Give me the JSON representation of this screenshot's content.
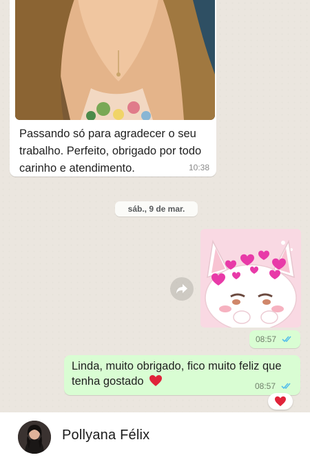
{
  "incoming": {
    "text": "Passando só para agradecer o seu trabalho.    Perfeito, obrigado por todo carinho e atendimento.",
    "time": "10:38"
  },
  "date_separator": "sáb., 9 de mar.",
  "sticker": {
    "icon": "cat-hearts-sticker",
    "bg": "#f9d9e3"
  },
  "sticker_message": {
    "time": "08:57",
    "status_icon": "double-check-icon"
  },
  "outgoing": {
    "text": "Linda, muito obrigado, fico muito feliz que tenha gostado",
    "time": "08:57",
    "status_icon": "double-check-icon",
    "emoji_icon": "red-heart-icon"
  },
  "reaction": {
    "icon": "red-heart-icon"
  },
  "footer": {
    "name": "Pollyana Félix"
  },
  "colors": {
    "chat_bg": "#ebe6df",
    "outgoing_bubble": "#d9fdd3",
    "read_ticks": "#53bdeb",
    "heart": "#e0233a"
  }
}
